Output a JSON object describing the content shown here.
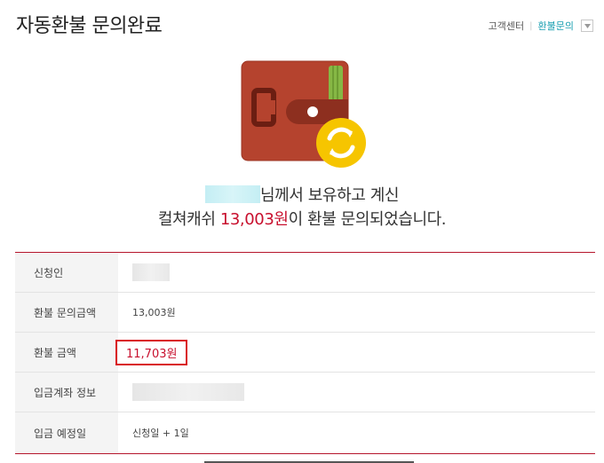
{
  "page": {
    "title": "자동환불 문의완료"
  },
  "topnav": {
    "customer_center": "고객센터",
    "separator": "|",
    "refund_inquiry": "환불문의",
    "dropdown_icon": "chevron-down-icon"
  },
  "colors": {
    "accent": "#1a9fb1",
    "red": "#c8102e",
    "wallet": "#b5432e",
    "coin": "#f6c500"
  },
  "message": {
    "line1_suffix": "님께서 보유하고 계신",
    "line2_prefix": "컬쳐캐쉬 ",
    "line2_amount": "13,003원",
    "line2_suffix": "이 환불 문의되었습니다."
  },
  "table": {
    "applicant_label": "신청인",
    "inquiry_amount_label": "환불 문의금액",
    "inquiry_amount_value": "13,003원",
    "refund_amount_label": "환불 금액",
    "refund_amount_value": "11,703원",
    "account_label": "입금계좌 정보",
    "deposit_date_label": "입금 예정일",
    "deposit_date_value": "신청일 + 1일"
  }
}
